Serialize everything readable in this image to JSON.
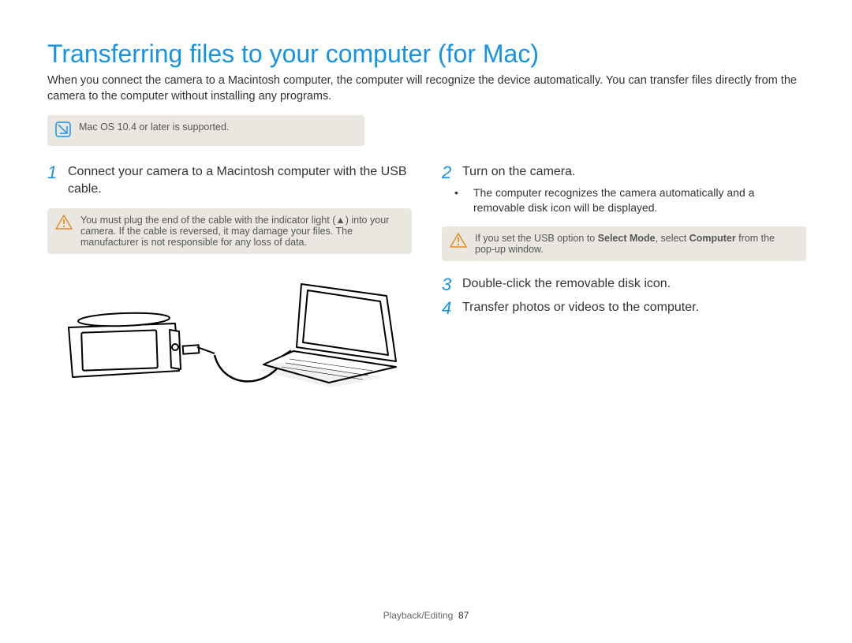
{
  "title": "Transferring files to your computer (for Mac)",
  "intro": "When you connect the camera to a Macintosh computer, the computer will recognize the device automatically. You can transfer files directly from the camera to the computer without installing any programs.",
  "info_note": "Mac OS 10.4 or later is supported.",
  "left": {
    "step1_num": "1",
    "step1_text": "Connect your camera to a Macintosh computer with the USB cable.",
    "warn1": "You must plug the end of the cable with the indicator light (▲) into your camera. If the cable is reversed, it may damage your files. The manufacturer is not responsible for any loss of data."
  },
  "right": {
    "step2_num": "2",
    "step2_text": "Turn on the camera.",
    "step2_sub": "The computer recognizes the camera automatically and a removable disk icon will be displayed.",
    "warn2_pre": "If you set the USB option to ",
    "warn2_b1": "Select Mode",
    "warn2_mid": ", select ",
    "warn2_b2": "Computer",
    "warn2_post": " from the pop-up window.",
    "step3_num": "3",
    "step3_text": "Double-click the removable disk icon.",
    "step4_num": "4",
    "step4_text": "Transfer photos or videos to the computer."
  },
  "footer_section": "Playback/Editing",
  "footer_page": "87"
}
